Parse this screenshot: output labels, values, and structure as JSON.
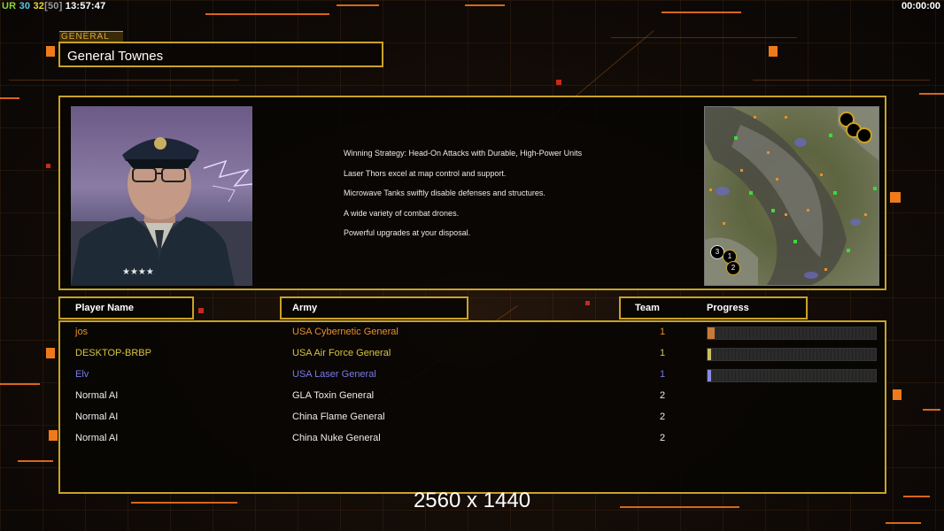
{
  "hud": {
    "ur_label": "UR",
    "fps_a": "30",
    "fps_b": "32",
    "fps_c": "[50]",
    "clock": "13:57:47",
    "game_timer": "00:00:00"
  },
  "general": {
    "label": "GENERAL",
    "name": "General Townes",
    "strategy": [
      "Winning Strategy: Head-On Attacks with Durable, High-Power Units",
      "Laser Thors excel at map control and support.",
      "Microwave Tanks swiftly disable defenses and structures.",
      "A wide variety of combat drones.",
      "Powerful upgrades at your disposal."
    ]
  },
  "minimap": {
    "start_markers": [
      "3",
      "1",
      "2"
    ]
  },
  "table": {
    "headers": {
      "player": "Player Name",
      "army": "Army",
      "team": "Team",
      "progress": "Progress"
    },
    "rows": [
      {
        "name": "jos",
        "army": "USA Cybernetic General",
        "team": "1",
        "color": "#e8902a",
        "progress": 0.04,
        "bar_color": "#c87a3a"
      },
      {
        "name": "DESKTOP-BRBP",
        "army": "USA Air Force General",
        "team": "1",
        "color": "#d8c43a",
        "progress": 0.02,
        "bar_color": "#c8c060"
      },
      {
        "name": "Elv",
        "army": "USA Laser General",
        "team": "1",
        "color": "#7a7ae8",
        "progress": 0.02,
        "bar_color": "#8a8ae0"
      },
      {
        "name": "Normal AI",
        "army": "GLA Toxin General",
        "team": "2",
        "color": "#ececec",
        "progress": null,
        "bar_color": ""
      },
      {
        "name": "Normal AI",
        "army": "China Flame General",
        "team": "2",
        "color": "#ececec",
        "progress": null,
        "bar_color": ""
      },
      {
        "name": "Normal AI",
        "army": "China Nuke General",
        "team": "2",
        "color": "#ececec",
        "progress": null,
        "bar_color": ""
      }
    ]
  },
  "resolution_label": "2560 x 1440"
}
